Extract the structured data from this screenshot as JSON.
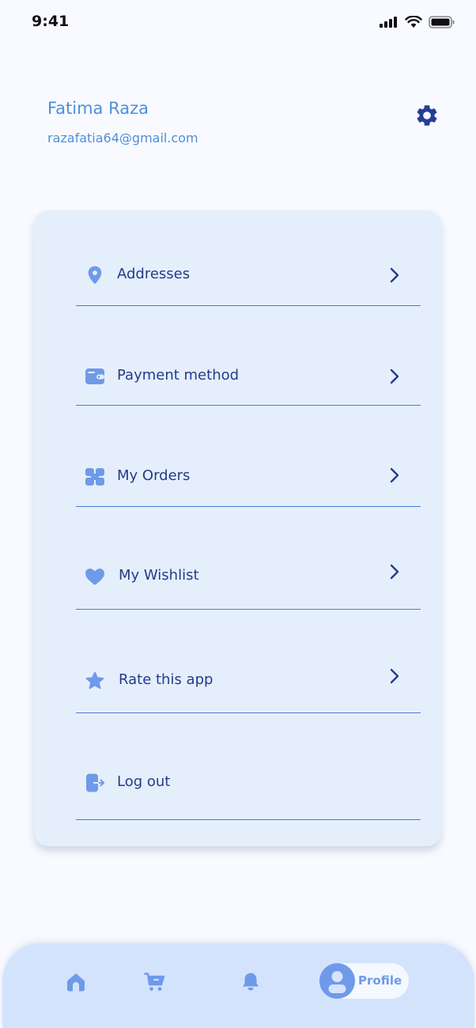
{
  "status_bar": {
    "time": "9:41"
  },
  "user": {
    "name": "Fatima Raza",
    "email": "razafatia64@gmail.com"
  },
  "menu": [
    {
      "label": "Addresses",
      "icon": "location-pin-icon"
    },
    {
      "label": "Payment method",
      "icon": "wallet-icon"
    },
    {
      "label": "My Orders",
      "icon": "orders-icon"
    },
    {
      "label": "My Wishlist",
      "icon": "heart-icon"
    },
    {
      "label": "Rate this app",
      "icon": "star-icon"
    },
    {
      "label": "Log out",
      "icon": "logout-icon"
    }
  ],
  "bottom_nav": {
    "items": [
      "home-icon",
      "cart-icon",
      "bell-icon",
      "profile-icon"
    ],
    "active_label": "Profile"
  },
  "colors": {
    "accent": "#6f9ae9",
    "text_primary": "#243a8c",
    "header_text": "#4f8fd8",
    "card_bg": "#e5effb",
    "nav_bg": "#d3e3fc"
  }
}
